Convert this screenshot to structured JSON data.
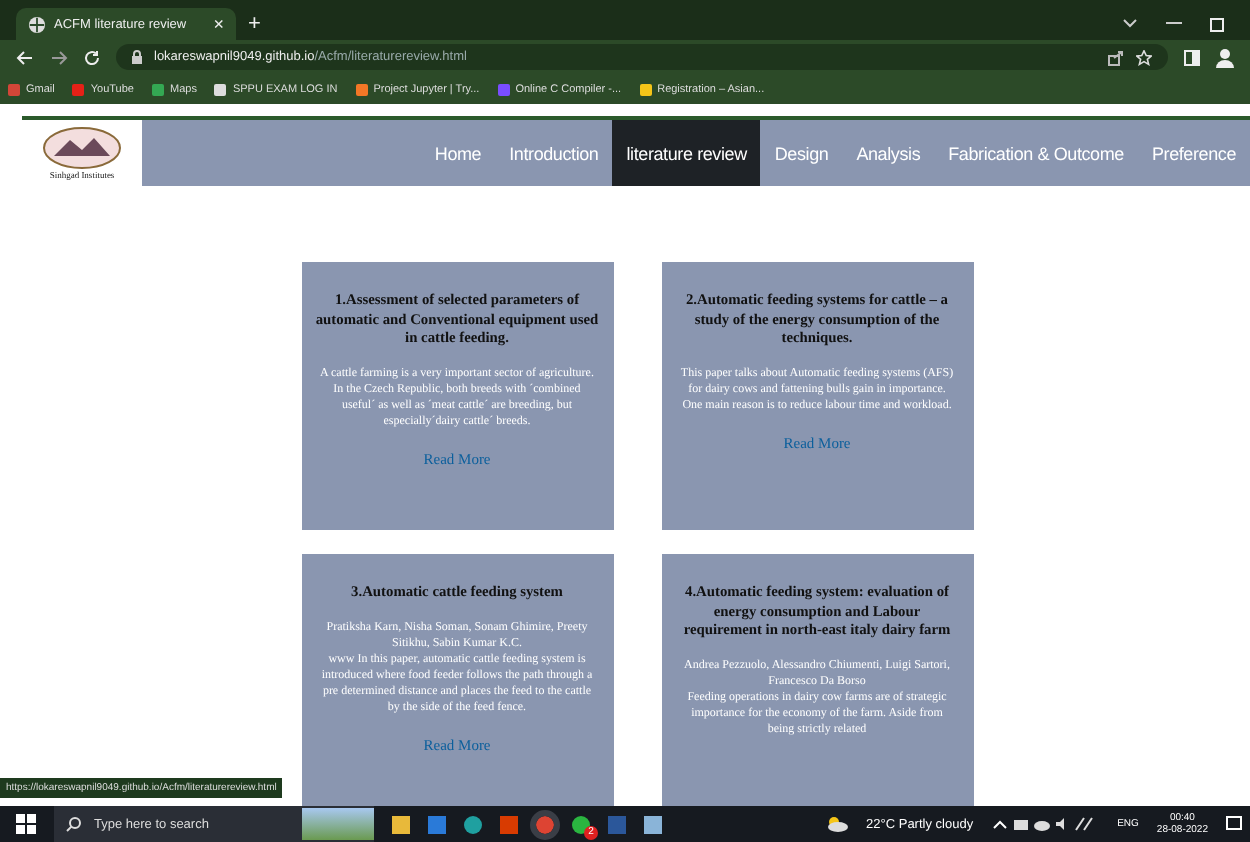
{
  "browser": {
    "tab_title": "ACFM literature review",
    "tab_close": "×",
    "new_tab": "+",
    "url_host": "lokareswapnil9049.github.io",
    "url_path": "/Acfm/literaturereview.html",
    "bookmarks": [
      {
        "label": "Gmail",
        "color": "#d44638"
      },
      {
        "label": "YouTube",
        "color": "#e62117"
      },
      {
        "label": "Maps",
        "color": "#34a853"
      },
      {
        "label": "SPPU EXAM LOG IN",
        "color": "#dddddd"
      },
      {
        "label": "Project Jupyter | Try...",
        "color": "#f37726"
      },
      {
        "label": "Online C Compiler -...",
        "color": "#7a4dff"
      },
      {
        "label": "Registration – Asian...",
        "color": "#f5c518"
      }
    ]
  },
  "site": {
    "logo_caption": "Sinhgad Institutes",
    "nav": [
      {
        "label": "Home",
        "selected": false
      },
      {
        "label": "Introduction",
        "selected": false
      },
      {
        "label": "literature review",
        "selected": true
      },
      {
        "label": "Design",
        "selected": false
      },
      {
        "label": "Analysis",
        "selected": false
      },
      {
        "label": "Fabrication & Outcome",
        "selected": false
      },
      {
        "label": "Preference",
        "selected": false
      }
    ],
    "cards": [
      {
        "title": "1.Assessment of selected parameters of automatic and Conventional equipment used in cattle feeding.",
        "body": [
          "A cattle farming is a very important sector of agriculture. In the Czech Republic, both breeds with ´combined",
          "useful´ as well as ´meat cattle´ are breeding, but especially´dairy cattle´ breeds."
        ],
        "link": "Read More"
      },
      {
        "title": "2.Automatic feeding systems for cattle – a study of the energy consumption of the techniques.",
        "body": [
          "This paper talks about Automatic feeding systems (AFS) for dairy cows and fattening bulls gain in importance.",
          "One main reason is to reduce labour time and workload."
        ],
        "link": "Read More"
      },
      {
        "title": "3.Automatic cattle feeding system",
        "body": [
          "Pratiksha Karn, Nisha Soman, Sonam Ghimire, Preety Sitikhu, Sabin Kumar K.C.",
          "www In this paper, automatic cattle feeding system is introduced where food feeder follows the path through a pre determined distance and places the feed to the cattle by the side of the feed fence."
        ],
        "link": "Read More"
      },
      {
        "title": "4.Automatic feeding system: evaluation of energy consumption and Labour requirement in north-east italy dairy farm",
        "body": [
          "Andrea Pezzuolo, Alessandro Chiumenti, Luigi Sartori, Francesco Da Borso",
          "Feeding operations in dairy cow farms are of strategic importance for the economy of the farm. Aside from being strictly related"
        ]
      }
    ]
  },
  "status_url": "https://lokareswapnil9049.github.io/Acfm/literaturereview.html",
  "taskbar": {
    "search_placeholder": "Type here to search",
    "notification_badge": "2",
    "weather": "22°C  Partly cloudy",
    "language": "ENG",
    "time": "00:40",
    "date": "28-08-2022"
  }
}
